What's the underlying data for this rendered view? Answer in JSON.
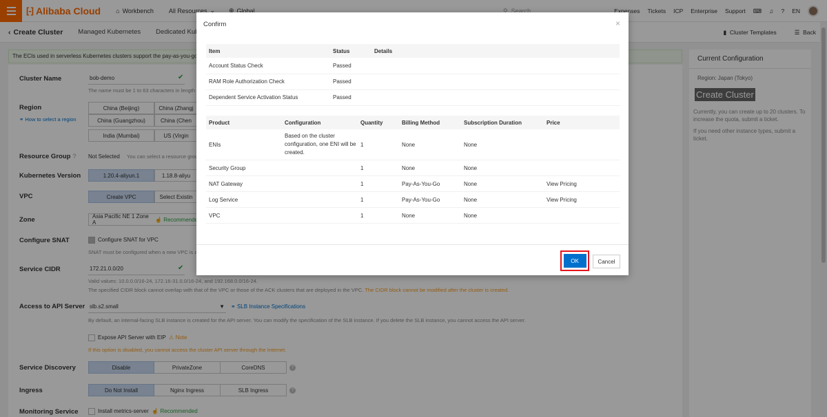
{
  "topbar": {
    "logo": "Alibaba Cloud",
    "workbench": "Workbench",
    "all_resources": "All Resources",
    "global": "Global",
    "search_placeholder": "Search...",
    "expenses": "Expenses",
    "tickets": "Tickets",
    "icp": "ICP",
    "enterprise": "Enterprise",
    "support": "Support",
    "lang": "EN"
  },
  "subheader": {
    "title": "Create Cluster",
    "tabs": [
      "Managed Kubernetes",
      "Dedicated Kubern"
    ],
    "cluster_templates": "Cluster Templates",
    "back": "Back"
  },
  "notice": "The ECIs used in serverless Kubernetes clusters support the pay-as-you-go billing",
  "form": {
    "cluster_name_label": "Cluster Name",
    "cluster_name_value": "bob-demo",
    "cluster_name_help": "The name must be 1 to 63 characters in length",
    "region_label": "Region",
    "region_help_link": "How to select a region",
    "regions": [
      "China (Beijing)",
      "China (Zhangj",
      "China (Guangzhou)",
      "China (Chen",
      "India (Mumbai)",
      "US (Virgin"
    ],
    "resource_group_label": "Resource Group",
    "resource_group_value": "Not Selected",
    "resource_group_help": "You can select a resource grou",
    "k8s_version_label": "Kubernetes Version",
    "k8s_versions": [
      "1.20.4-aliyun.1",
      "1.18.8-aliyu"
    ],
    "vpc_label": "VPC",
    "vpc_options": [
      "Create VPC",
      "Select Existin"
    ],
    "zone_label": "Zone",
    "zone_value": "Asia Pacific NE 1 Zone A",
    "zone_recommended": "Recommende",
    "snat_label": "Configure SNAT",
    "snat_checkbox": "Configure SNAT for VPC",
    "snat_help": "SNAT must be configured when a new VPC is a",
    "cidr_label": "Service CIDR",
    "cidr_value": "172.21.0.0/20",
    "cidr_help1": "Valid values: 10.0.0.0/16-24, 172.16-31.0.0/16-24, and 192.168.0.0/16-24.",
    "cidr_help2": "The specified CIDR block cannot overlap with that of the VPC or those of the ACK clusters that are deployed in the VPC.",
    "cidr_help_warn": "The CIDR block cannot be modified after the cluster is created.",
    "api_label": "Access to API Server",
    "api_value": "slb.s2.small",
    "api_link": "SLB Instance Specifications",
    "api_help": "By default, an internal-facing SLB instance is created for the API server. You can modify the specification of the SLB instance. If you delete the SLB instance, you cannot access the API server.",
    "eip_checkbox": "Expose API Server with EIP",
    "eip_note": "Note",
    "eip_warn": "If this option is disabled, you cannot access the cluster API server through the Internet.",
    "discovery_label": "Service Discovery",
    "discovery_options": [
      "Disable",
      "PrivateZone",
      "CoreDNS"
    ],
    "ingress_label": "Ingress",
    "ingress_options": [
      "Do Not Install",
      "Nginx Ingress",
      "SLB Ingress"
    ],
    "monitoring_label": "Monitoring Service",
    "monitoring_checkbox": "Install metrics-server",
    "monitoring_recommended": "Recommended"
  },
  "side": {
    "title": "Current Configuration",
    "region": "Region: Japan (Tokyo)",
    "create_button": "Create Cluster",
    "note1": "Currently, you can create up to 20 clusters. To increase the quota, submit a ticket.",
    "note2": "If you need other instance types, submit a ticket."
  },
  "modal": {
    "title": "Confirm",
    "check_headers": [
      "Item",
      "Status",
      "Details"
    ],
    "checks": [
      {
        "item": "Account Status Check",
        "status": "Passed"
      },
      {
        "item": "RAM Role Authorization Check",
        "status": "Passed"
      },
      {
        "item": "Dependent Service Activation Status",
        "status": "Passed"
      }
    ],
    "product_headers": [
      "Product",
      "Configuration",
      "Quantity",
      "Billing Method",
      "Subscription Duration",
      "Price"
    ],
    "products": [
      {
        "product": "ENIs",
        "configuration": "Based on the cluster configuration, one ENI will be created.",
        "quantity": "1",
        "billing": "None",
        "duration": "None",
        "price": ""
      },
      {
        "product": "Security Group",
        "configuration": "",
        "quantity": "1",
        "billing": "None",
        "duration": "None",
        "price": ""
      },
      {
        "product": "NAT Gateway",
        "configuration": "",
        "quantity": "1",
        "billing": "Pay-As-You-Go",
        "duration": "None",
        "price": "View Pricing"
      },
      {
        "product": "Log Service",
        "configuration": "",
        "quantity": "1",
        "billing": "Pay-As-You-Go",
        "duration": "None",
        "price": "View Pricing"
      },
      {
        "product": "VPC",
        "configuration": "",
        "quantity": "1",
        "billing": "None",
        "duration": "None",
        "price": ""
      }
    ],
    "ok": "OK",
    "cancel": "Cancel"
  },
  "colors": {
    "brand": "#ff6a00",
    "primary": "#0070cc",
    "passed": "#2a9c3e",
    "highlight": "#e4141b"
  }
}
